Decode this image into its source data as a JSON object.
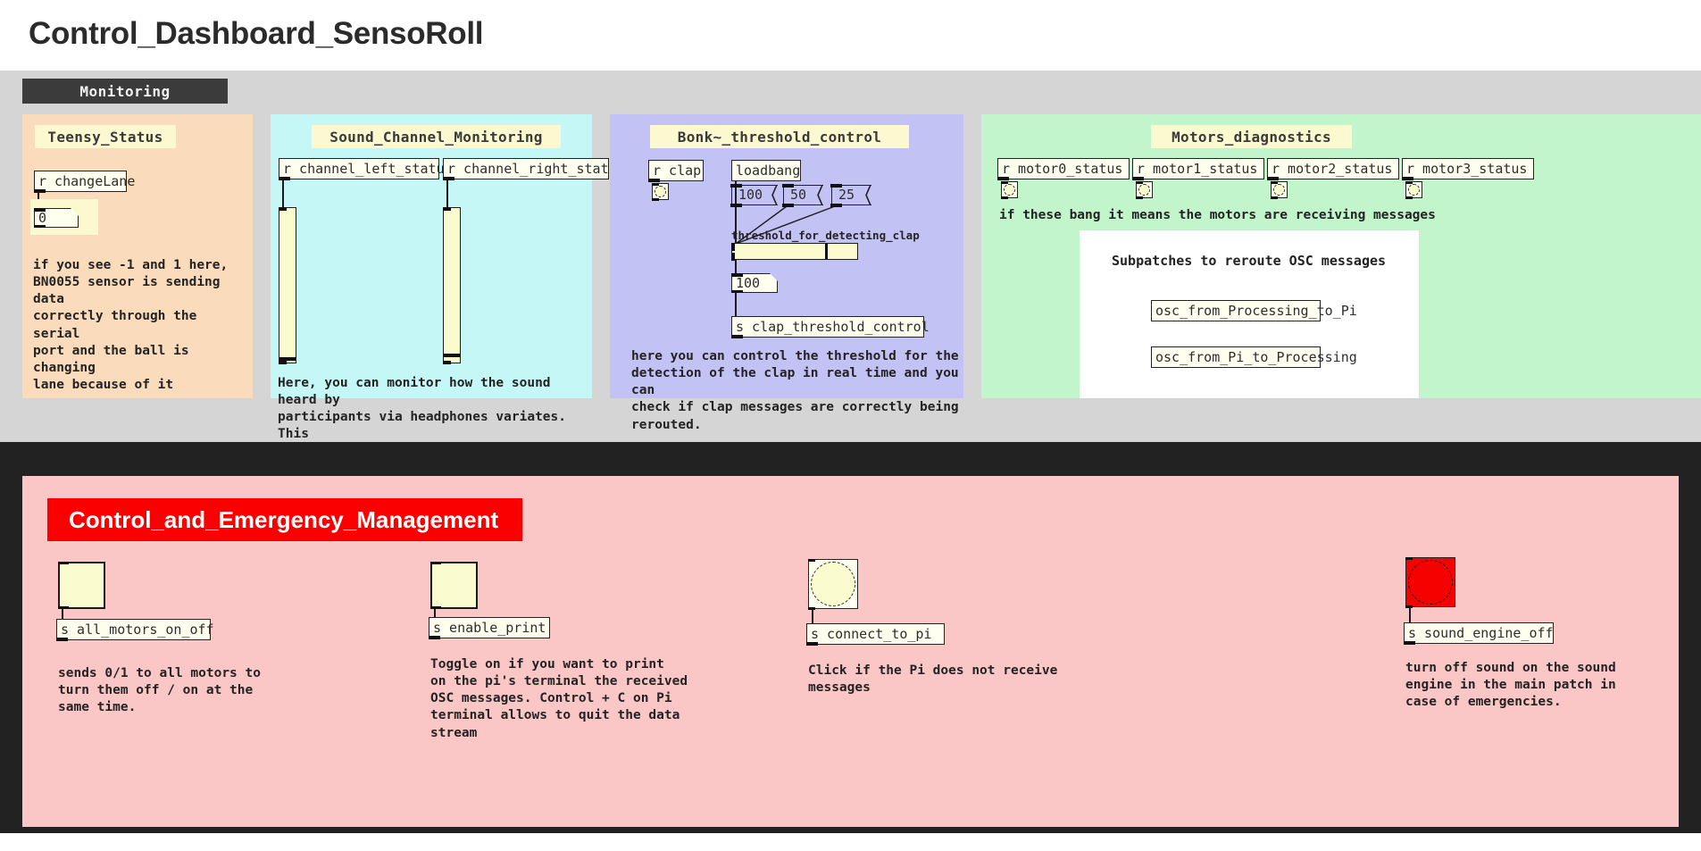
{
  "window": {
    "title": "Control_Dashboard_SensoRoll"
  },
  "monitoring": {
    "tab_label": "Monitoring",
    "panels": {
      "teensy": {
        "title": "Teensy_Status",
        "receive_object": "r changeLane",
        "number_value": "0",
        "comment": "if you see -1 and 1 here,\nBN0055 sensor is sending data\ncorrectly through the serial\nport and the ball is changing\nlane because of it"
      },
      "sound": {
        "title": "Sound_Channel_Monitoring",
        "left_receive": "r channel_left_status",
        "right_receive": "r channel_right_status",
        "left_slider_value": 3,
        "right_slider_value": 6,
        "comment": "Here, you can monitor how the sound heard by\nparticipants via headphones variates. This\nensures that the sound system is working\nproperly and responding to the current mode\nof the game."
      },
      "bonk": {
        "title": "Bonk~_threshold_control",
        "clap_receive": "r clap",
        "loadbang": "loadbang",
        "messages": [
          "100",
          "50",
          "25"
        ],
        "slider_label": "threshold_for_detecting_clap",
        "slider_value": 100,
        "slider_max": 135,
        "number_value": "100",
        "send_object": "s clap_threshold_control",
        "comment": "here you can control the threshold for the\ndetection of the clap in real time and you can\ncheck if clap messages are correctly being\nrerouted."
      },
      "motors": {
        "title": "Motors_diagnostics",
        "receives": [
          "r motor0_status",
          "r motor1_status",
          "r motor2_status",
          "r motor3_status"
        ],
        "comment": "if these bang it means the motors are receiving messages",
        "subpatch_heading": "Subpatches to reroute OSC messages",
        "subpatch_objects": [
          "osc_from_Processing_to_Pi",
          "osc_from_Pi_to_Processing"
        ]
      }
    }
  },
  "emergency": {
    "title": "Control_and_Emergency_Management",
    "controls": [
      {
        "type": "toggle",
        "send": "s all_motors_on_off",
        "comment": "sends 0/1 to all motors to\nturn them off / on at the\nsame time."
      },
      {
        "type": "toggle",
        "send": "s enable_print",
        "comment": "Toggle on if you want to print\non the pi's terminal the received\nOSC messages. Control + C on Pi\nterminal allows to quit the data\nstream"
      },
      {
        "type": "bang",
        "send": "s connect_to_pi",
        "comment": "Click if the Pi does not receive\nmessages"
      },
      {
        "type": "bang-red",
        "send": "s sound_engine_off",
        "comment": "turn off sound on the sound\nengine in the main patch in\ncase of emergencies."
      }
    ]
  },
  "colors": {
    "teensy_bg": "#fadcbd",
    "sound_bg": "#c5f7f7",
    "bonk_bg": "#c3c2f5",
    "motors_bg": "#c2f5cb",
    "emergency_bg": "#fac6c6",
    "emergency_title_bg": "#fa0000",
    "tab_bg": "#3b3b3b",
    "panel_title_bg": "#fcf8cf",
    "object_bg": "#fffff0",
    "bang_red": "#f60000"
  }
}
